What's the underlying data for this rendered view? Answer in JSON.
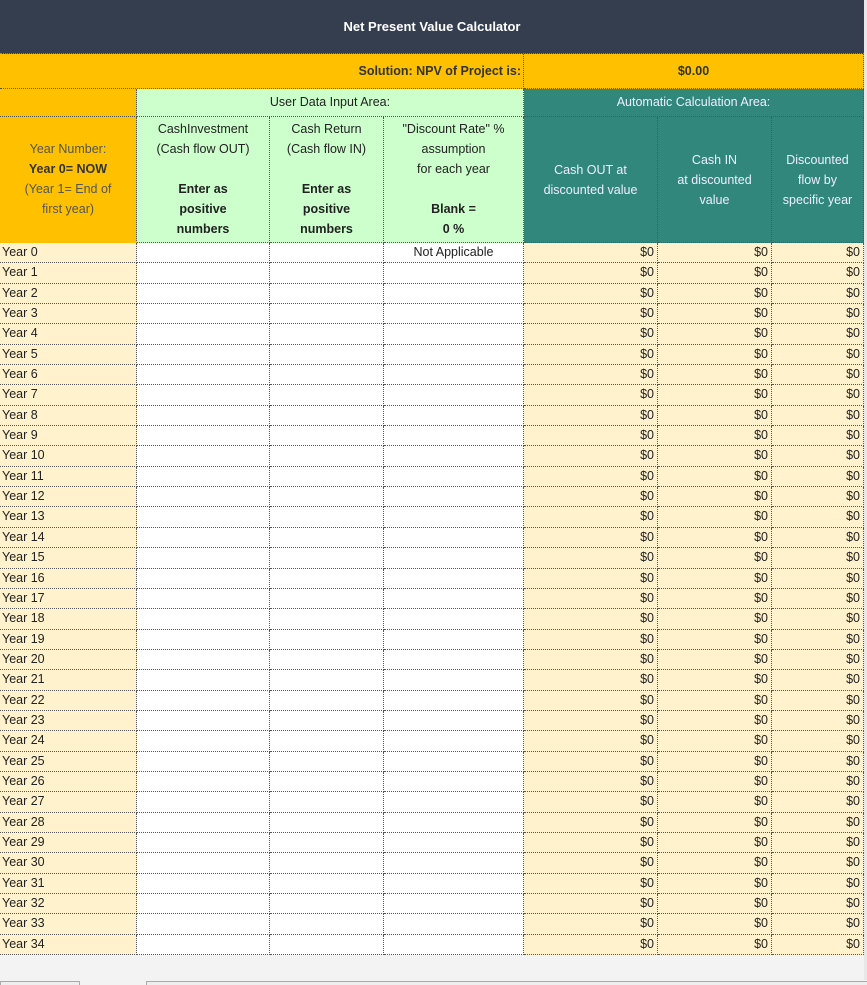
{
  "title": "Net Present Value Calculator",
  "solution": {
    "label": "Solution: NPV of Project is:",
    "value": "$0.00"
  },
  "sections": {
    "input": "User Data Input Area:",
    "auto": "Automatic Calculation Area:"
  },
  "headers": {
    "year": {
      "line1": "Year Number:",
      "line2": "Year 0= NOW",
      "line3": "(Year 1= End of",
      "line4": "first year)"
    },
    "investment": {
      "line1": "CashInvestment",
      "line2": "(Cash flow OUT)",
      "line3": "Enter as",
      "line4": "positive",
      "line5": "numbers"
    },
    "return": {
      "line1": "Cash Return",
      "line2": "(Cash flow IN)",
      "line3": "Enter as",
      "line4": "positive",
      "line5": "numbers"
    },
    "rate": {
      "line1": "\"Discount Rate\" %",
      "line2": "assumption",
      "line3": "for each year",
      "line4": "Blank =",
      "line5": "0 %"
    },
    "cash_out": {
      "line1": "Cash OUT at",
      "line2": "discounted value"
    },
    "cash_in": {
      "line1": "Cash IN",
      "line2": "at discounted",
      "line3": "value"
    },
    "discounted": {
      "line1": "Discounted",
      "line2": "flow by",
      "line3": "specific year"
    }
  },
  "rows": [
    {
      "year": "Year 0",
      "investment": "",
      "return": "",
      "rate": "Not Applicable",
      "cash_out": "$0",
      "cash_in": "$0",
      "discounted": "$0"
    },
    {
      "year": "Year 1",
      "investment": "",
      "return": "",
      "rate": "",
      "cash_out": "$0",
      "cash_in": "$0",
      "discounted": "$0"
    },
    {
      "year": "Year 2",
      "investment": "",
      "return": "",
      "rate": "",
      "cash_out": "$0",
      "cash_in": "$0",
      "discounted": "$0"
    },
    {
      "year": "Year 3",
      "investment": "",
      "return": "",
      "rate": "",
      "cash_out": "$0",
      "cash_in": "$0",
      "discounted": "$0"
    },
    {
      "year": "Year 4",
      "investment": "",
      "return": "",
      "rate": "",
      "cash_out": "$0",
      "cash_in": "$0",
      "discounted": "$0"
    },
    {
      "year": "Year 5",
      "investment": "",
      "return": "",
      "rate": "",
      "cash_out": "$0",
      "cash_in": "$0",
      "discounted": "$0"
    },
    {
      "year": "Year 6",
      "investment": "",
      "return": "",
      "rate": "",
      "cash_out": "$0",
      "cash_in": "$0",
      "discounted": "$0"
    },
    {
      "year": "Year 7",
      "investment": "",
      "return": "",
      "rate": "",
      "cash_out": "$0",
      "cash_in": "$0",
      "discounted": "$0"
    },
    {
      "year": "Year 8",
      "investment": "",
      "return": "",
      "rate": "",
      "cash_out": "$0",
      "cash_in": "$0",
      "discounted": "$0"
    },
    {
      "year": "Year 9",
      "investment": "",
      "return": "",
      "rate": "",
      "cash_out": "$0",
      "cash_in": "$0",
      "discounted": "$0"
    },
    {
      "year": "Year 10",
      "investment": "",
      "return": "",
      "rate": "",
      "cash_out": "$0",
      "cash_in": "$0",
      "discounted": "$0"
    },
    {
      "year": "Year 11",
      "investment": "",
      "return": "",
      "rate": "",
      "cash_out": "$0",
      "cash_in": "$0",
      "discounted": "$0"
    },
    {
      "year": "Year 12",
      "investment": "",
      "return": "",
      "rate": "",
      "cash_out": "$0",
      "cash_in": "$0",
      "discounted": "$0"
    },
    {
      "year": "Year 13",
      "investment": "",
      "return": "",
      "rate": "",
      "cash_out": "$0",
      "cash_in": "$0",
      "discounted": "$0"
    },
    {
      "year": "Year 14",
      "investment": "",
      "return": "",
      "rate": "",
      "cash_out": "$0",
      "cash_in": "$0",
      "discounted": "$0"
    },
    {
      "year": "Year 15",
      "investment": "",
      "return": "",
      "rate": "",
      "cash_out": "$0",
      "cash_in": "$0",
      "discounted": "$0"
    },
    {
      "year": "Year 16",
      "investment": "",
      "return": "",
      "rate": "",
      "cash_out": "$0",
      "cash_in": "$0",
      "discounted": "$0"
    },
    {
      "year": "Year 17",
      "investment": "",
      "return": "",
      "rate": "",
      "cash_out": "$0",
      "cash_in": "$0",
      "discounted": "$0"
    },
    {
      "year": "Year 18",
      "investment": "",
      "return": "",
      "rate": "",
      "cash_out": "$0",
      "cash_in": "$0",
      "discounted": "$0"
    },
    {
      "year": "Year 19",
      "investment": "",
      "return": "",
      "rate": "",
      "cash_out": "$0",
      "cash_in": "$0",
      "discounted": "$0"
    },
    {
      "year": "Year 20",
      "investment": "",
      "return": "",
      "rate": "",
      "cash_out": "$0",
      "cash_in": "$0",
      "discounted": "$0"
    },
    {
      "year": "Year 21",
      "investment": "",
      "return": "",
      "rate": "",
      "cash_out": "$0",
      "cash_in": "$0",
      "discounted": "$0"
    },
    {
      "year": "Year 22",
      "investment": "",
      "return": "",
      "rate": "",
      "cash_out": "$0",
      "cash_in": "$0",
      "discounted": "$0"
    },
    {
      "year": "Year 23",
      "investment": "",
      "return": "",
      "rate": "",
      "cash_out": "$0",
      "cash_in": "$0",
      "discounted": "$0"
    },
    {
      "year": "Year 24",
      "investment": "",
      "return": "",
      "rate": "",
      "cash_out": "$0",
      "cash_in": "$0",
      "discounted": "$0"
    },
    {
      "year": "Year 25",
      "investment": "",
      "return": "",
      "rate": "",
      "cash_out": "$0",
      "cash_in": "$0",
      "discounted": "$0"
    },
    {
      "year": "Year 26",
      "investment": "",
      "return": "",
      "rate": "",
      "cash_out": "$0",
      "cash_in": "$0",
      "discounted": "$0"
    },
    {
      "year": "Year 27",
      "investment": "",
      "return": "",
      "rate": "",
      "cash_out": "$0",
      "cash_in": "$0",
      "discounted": "$0"
    },
    {
      "year": "Year 28",
      "investment": "",
      "return": "",
      "rate": "",
      "cash_out": "$0",
      "cash_in": "$0",
      "discounted": "$0"
    },
    {
      "year": "Year 29",
      "investment": "",
      "return": "",
      "rate": "",
      "cash_out": "$0",
      "cash_in": "$0",
      "discounted": "$0"
    },
    {
      "year": "Year 30",
      "investment": "",
      "return": "",
      "rate": "",
      "cash_out": "$0",
      "cash_in": "$0",
      "discounted": "$0"
    },
    {
      "year": "Year 31",
      "investment": "",
      "return": "",
      "rate": "",
      "cash_out": "$0",
      "cash_in": "$0",
      "discounted": "$0"
    },
    {
      "year": "Year 32",
      "investment": "",
      "return": "",
      "rate": "",
      "cash_out": "$0",
      "cash_in": "$0",
      "discounted": "$0"
    },
    {
      "year": "Year 33",
      "investment": "",
      "return": "",
      "rate": "",
      "cash_out": "$0",
      "cash_in": "$0",
      "discounted": "$0"
    },
    {
      "year": "Year 34",
      "investment": "",
      "return": "",
      "rate": "",
      "cash_out": "$0",
      "cash_in": "$0",
      "discounted": "$0"
    }
  ]
}
